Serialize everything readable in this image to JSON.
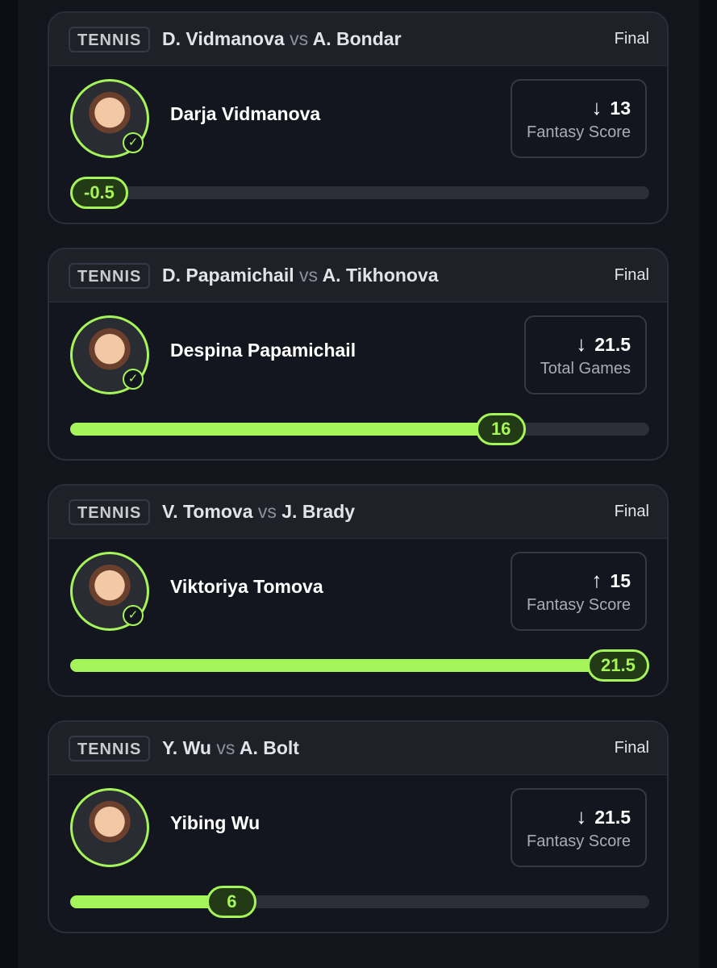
{
  "theme": {
    "accent": "#a5f55a",
    "background": "#14161f",
    "header": "#1f2129"
  },
  "cards": [
    {
      "sport": "TENNIS",
      "player1": "D. Vidmanova",
      "vs": "vs",
      "player2": "A. Bondar",
      "status": "Final",
      "player_name": "Darja Vidmanova",
      "direction_icon": "arrow-down-icon",
      "arrow": "↓",
      "line": "13",
      "stat_label": "Fantasy Score",
      "result": "-0.5",
      "progress_fraction": 0
    },
    {
      "sport": "TENNIS",
      "player1": "D. Papamichail",
      "vs": "vs",
      "player2": "A. Tikhonova",
      "status": "Final",
      "player_name": "Despina Papamichail",
      "direction_icon": "arrow-down-icon",
      "arrow": "↓",
      "line": "21.5",
      "stat_label": "Total Games",
      "result": "16",
      "progress_fraction": 0.744
    },
    {
      "sport": "TENNIS",
      "player1": "V. Tomova",
      "vs": "vs",
      "player2": "J. Brady",
      "status": "Final",
      "player_name": "Viktoriya Tomova",
      "direction_icon": "arrow-up-icon",
      "arrow": "↑",
      "line": "15",
      "stat_label": "Fantasy Score",
      "result": "21.5",
      "progress_fraction": 1
    },
    {
      "sport": "TENNIS",
      "player1": "Y. Wu",
      "vs": "vs",
      "player2": "A. Bolt",
      "status": "Final",
      "player_name": "Yibing Wu",
      "direction_icon": "arrow-down-icon",
      "arrow": "↓",
      "line": "21.5",
      "stat_label": "Fantasy Score",
      "result": "6",
      "progress_fraction": 0.279
    }
  ]
}
